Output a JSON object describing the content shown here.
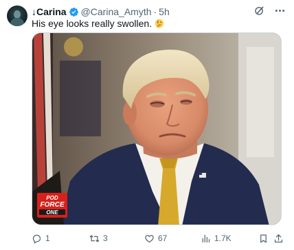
{
  "post": {
    "author": {
      "display_name": "↓Carina",
      "handle": "@Carina_Amyth",
      "separator": "·",
      "time": "5h",
      "verified": true
    },
    "text": "His eye looks really swollen.",
    "emoji": "thinking-face",
    "media": {
      "badge_lines": [
        "POD",
        "FORCE",
        "ONE"
      ]
    },
    "actions": {
      "replies": "1",
      "reposts": "3",
      "likes": "67",
      "views": "1.7K"
    }
  },
  "colors": {
    "text_primary": "#0f1419",
    "text_secondary": "#536471",
    "verified_blue": "#1d9bf0",
    "border": "#cfd9de",
    "badge_red": "#d7211b"
  },
  "icons": {
    "top_actions": [
      "grok-icon",
      "more-icon"
    ],
    "action_bar": [
      "reply-icon",
      "repost-icon",
      "like-icon",
      "views-icon",
      "bookmark-icon",
      "share-icon"
    ]
  }
}
